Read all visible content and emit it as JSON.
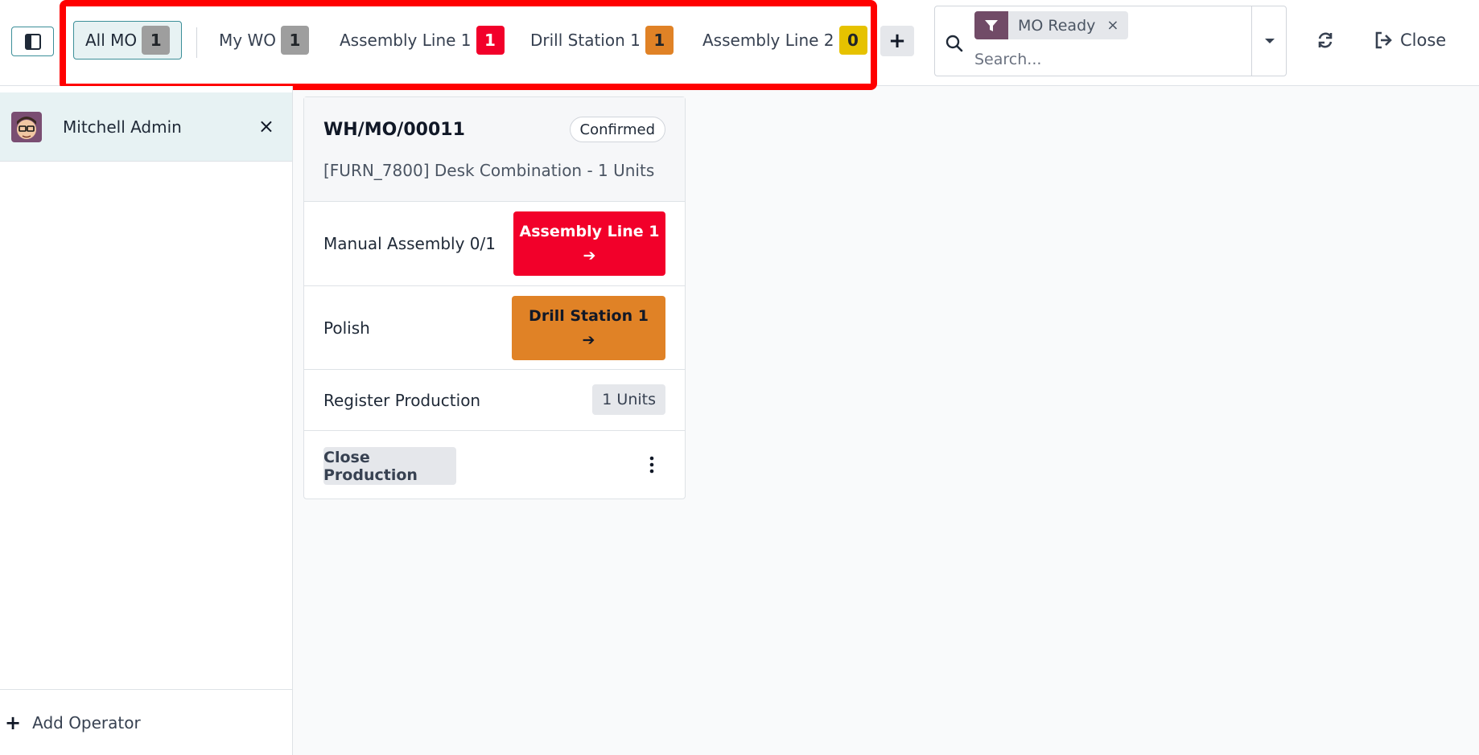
{
  "topbar": {
    "tabs": [
      {
        "label": "All MO",
        "count": "1",
        "badge_bg": "#9e9e9e",
        "badge_fg": "#212529",
        "active": true
      },
      {
        "label": "My WO",
        "count": "1",
        "badge_bg": "#9e9e9e",
        "badge_fg": "#212529",
        "active": false
      },
      {
        "label": "Assembly Line 1",
        "count": "1",
        "badge_bg": "#f2002a",
        "badge_fg": "#ffffff",
        "active": false
      },
      {
        "label": "Drill Station 1",
        "count": "1",
        "badge_bg": "#e08226",
        "badge_fg": "#212529",
        "active": false
      },
      {
        "label": "Assembly Line 2",
        "count": "0",
        "badge_bg": "#e6c200",
        "badge_fg": "#212529",
        "active": false
      }
    ],
    "add_tab_symbol": "+",
    "search": {
      "facet_label": "MO Ready",
      "facet_remove": "×",
      "placeholder": "Search..."
    },
    "close_label": "Close"
  },
  "sidebar": {
    "operator_name": "Mitchell Admin",
    "operator_remove": "×",
    "add_operator_label": "Add Operator"
  },
  "card": {
    "reference": "WH/MO/00011",
    "status": "Confirmed",
    "product": "[FURN_7800] Desk Combination - 1 Units",
    "operations": [
      {
        "label": "Manual Assembly  0/1",
        "workcenter": "Assembly Line 1",
        "arrow": "➔",
        "bg": "#f2002a",
        "fg": "#ffffff"
      },
      {
        "label": "Polish",
        "workcenter": "Drill Station 1",
        "arrow": "➔",
        "bg": "#e08226",
        "fg": "#111827"
      }
    ],
    "register_label": "Register Production",
    "register_units": "1 Units",
    "close_production_label": "Close Production"
  },
  "colors": {
    "accent": "#3c8f99",
    "facet": "#714b67",
    "highlight": "#ff0000"
  }
}
